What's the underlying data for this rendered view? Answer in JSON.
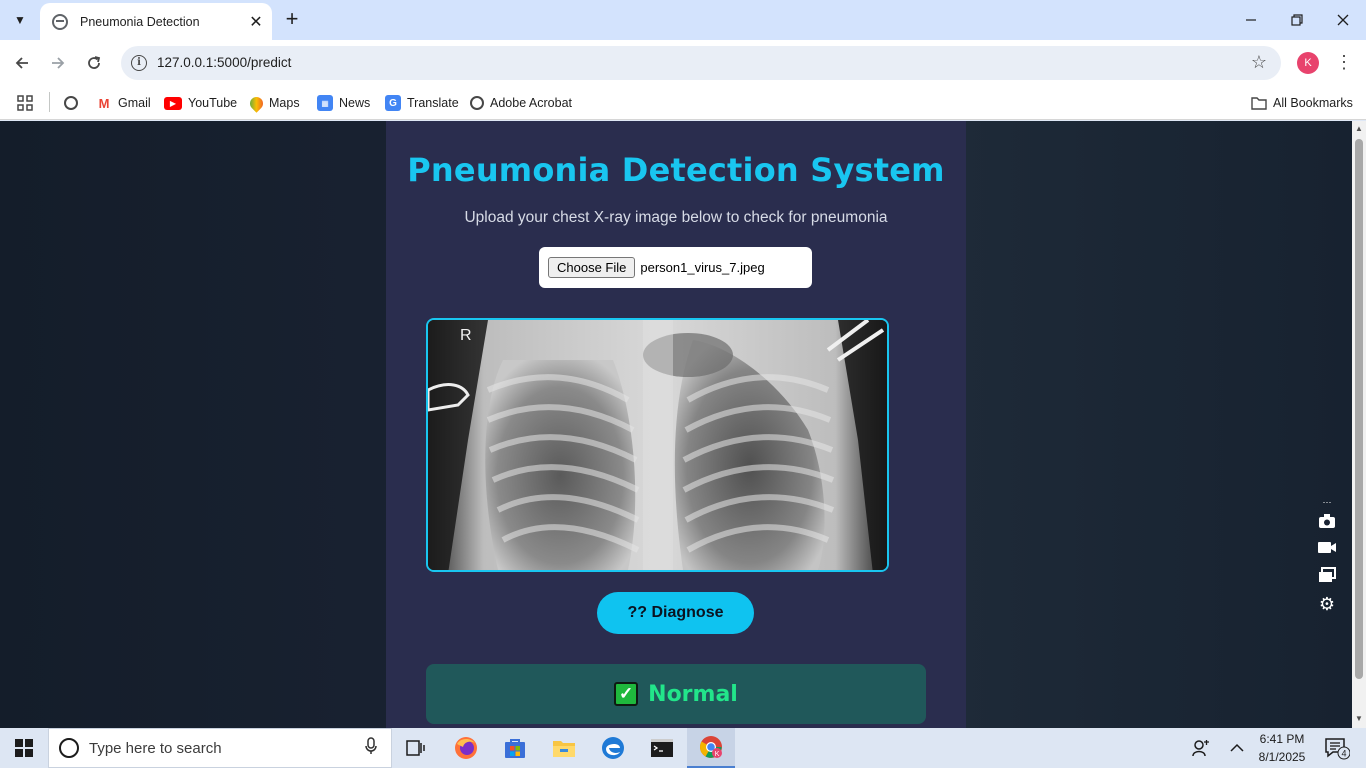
{
  "browser": {
    "tab_title": "Pneumonia Detection",
    "url": "127.0.0.1:5000/predict",
    "profile_initial": "K",
    "new_tab_symbol": "+",
    "bookmarks": [
      {
        "label": "Gmail",
        "icon": "gmail-icon"
      },
      {
        "label": "YouTube",
        "icon": "youtube-icon"
      },
      {
        "label": "Maps",
        "icon": "maps-icon"
      },
      {
        "label": "News",
        "icon": "news-icon"
      },
      {
        "label": "Translate",
        "icon": "translate-icon"
      },
      {
        "label": "Adobe Acrobat",
        "icon": "globe-icon"
      }
    ],
    "all_bookmarks_label": "All Bookmarks"
  },
  "page": {
    "title": "Pneumonia Detection System",
    "subtitle": "Upload your chest X-ray image below to check for pneumonia",
    "file_button_label": "Choose File",
    "file_name": "person1_virus_7.jpeg",
    "xray_marker": "R",
    "diagnose_label": "?? Diagnose",
    "result_label": "Normal",
    "colors": {
      "accent": "#19c6f0",
      "card": "#2a2d4e",
      "result_bg": "#20585a",
      "result_text": "#22e58a"
    }
  },
  "taskbar": {
    "search_placeholder": "Type here to search",
    "time": "6:41 PM",
    "date": "8/1/2025",
    "notification_count": "4"
  }
}
